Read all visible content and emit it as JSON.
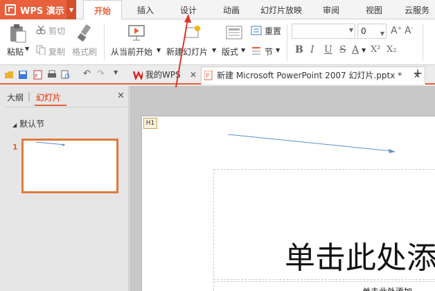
{
  "app": {
    "name": "WPS 演示"
  },
  "menu_tabs": [
    "开始",
    "插入",
    "设计",
    "动画",
    "幻灯片放映",
    "审阅",
    "视图",
    "云服务"
  ],
  "active_tab": "开始",
  "ribbon": {
    "paste": "粘贴",
    "cut": "剪切",
    "copy": "复制",
    "format_painter": "格式刷",
    "from_current": "从当前开始",
    "new_slide": "新建幻灯片",
    "layout": "版式",
    "reset": "重置",
    "section": "节",
    "font_size": "0",
    "grow_font": "A",
    "shrink_font": "A",
    "bold": "B",
    "italic": "I",
    "underline": "U",
    "strike": "S",
    "font_color": "A",
    "superscript": "X²",
    "subscript": "X₂"
  },
  "doc_tabs": [
    {
      "label": "我的WPS",
      "active": false
    },
    {
      "label": "新建 Microsoft PowerPoint 2007 幻灯片.pptx *",
      "active": true
    }
  ],
  "new_tab": "+",
  "left_panel": {
    "tab_outline": "大纲",
    "tab_slides": "幻灯片",
    "section_name": "默认节",
    "slide_number": "1"
  },
  "slide": {
    "tag": "H1",
    "title_placeholder": "单击此处添",
    "subtitle_placeholder": "单击此处添加"
  },
  "colors": {
    "accent": "#e8603c",
    "annotation_arrow": "#e0332a",
    "slide_line": "#5b8fc9"
  }
}
